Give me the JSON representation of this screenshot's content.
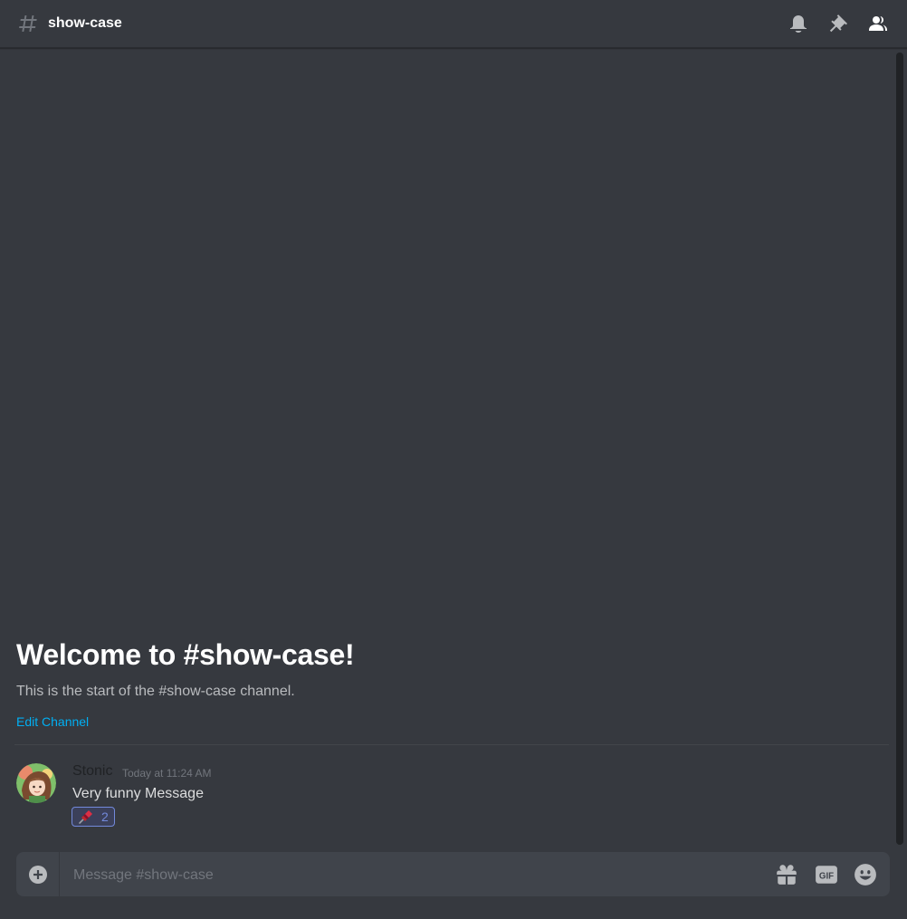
{
  "header": {
    "hash_icon": "hash-icon",
    "channel_name": "show-case",
    "toolbar": [
      {
        "icon": "bell-icon"
      },
      {
        "icon": "pin-icon"
      },
      {
        "icon": "members-icon"
      }
    ]
  },
  "welcome": {
    "title": "Welcome to #show-case!",
    "subtitle": "This is the start of the #show-case channel.",
    "edit_link": "Edit Channel"
  },
  "message": {
    "author": "Stonic",
    "timestamp": "Today at 11:24 AM",
    "content": "Very funny Message",
    "reaction": {
      "emoji": "pushpin-icon",
      "count": "2"
    }
  },
  "composer": {
    "placeholder": "Message #show-case",
    "value": "",
    "buttons": [
      {
        "icon": "plus-circle-icon"
      },
      {
        "icon": "gift-icon"
      },
      {
        "icon": "gif-icon"
      },
      {
        "icon": "emoji-icon"
      }
    ]
  },
  "colors": {
    "background": "#36393f",
    "header_text": "#ffffff",
    "link": "#00b0f4",
    "muted_text": "#b9bbbe",
    "icon": "#b9bbbe",
    "reaction_border": "#7289da",
    "input_bg": "#40444b"
  }
}
